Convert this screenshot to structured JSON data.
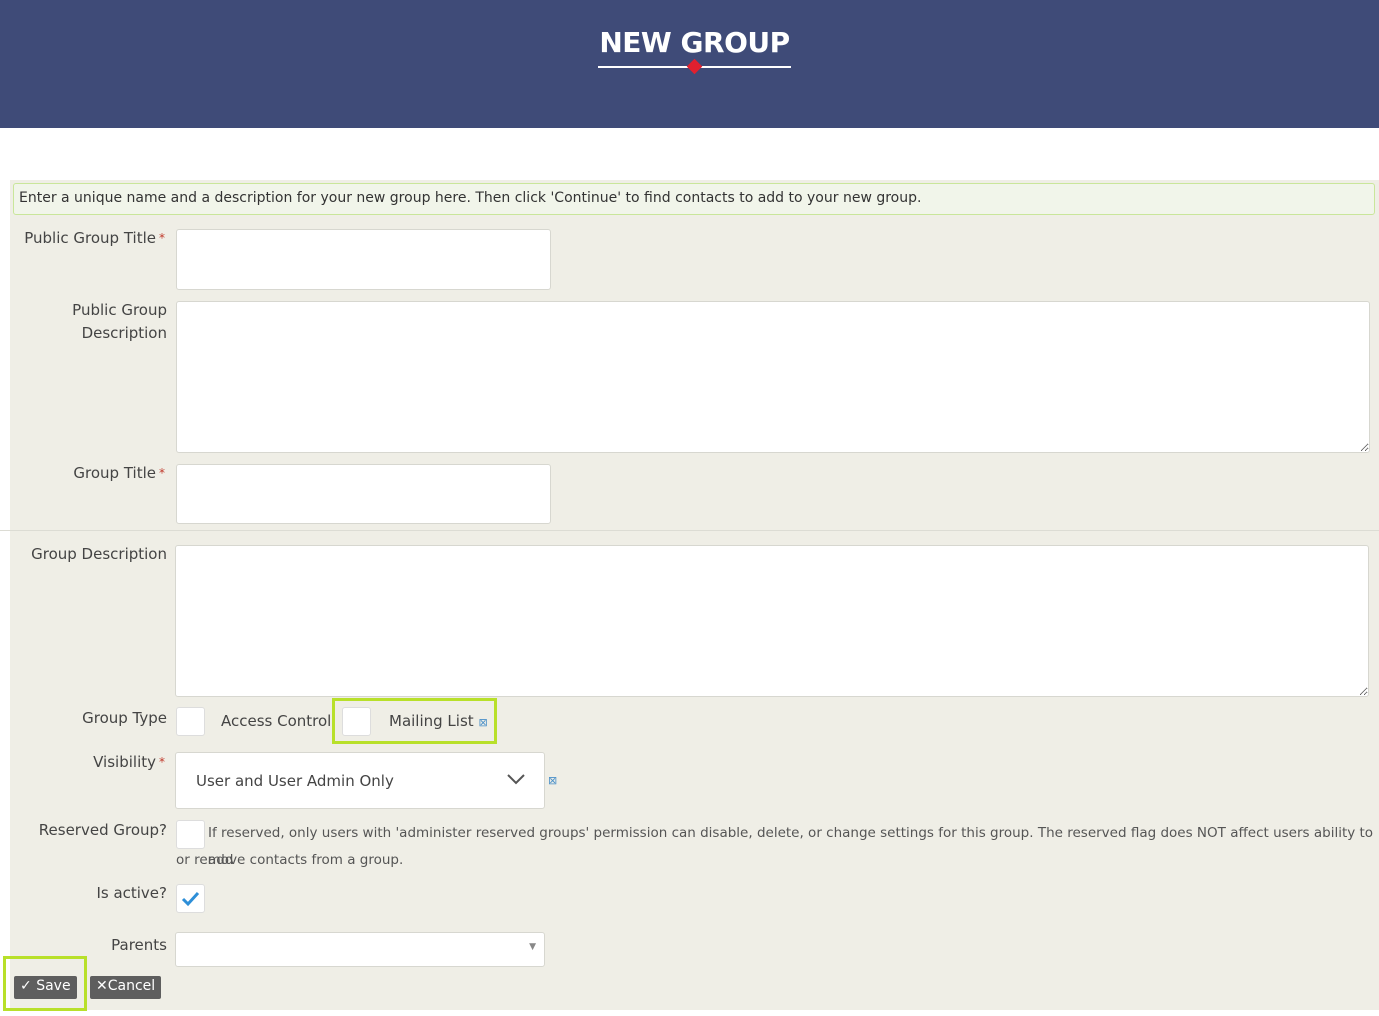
{
  "header": {
    "title": "NEW GROUP"
  },
  "help_text": "Enter a unique name and a description for your new group here. Then click 'Continue' to find contacts to add to your new group.",
  "form": {
    "public_title_label": "Public Group Title",
    "public_desc_label_1": "Public Group",
    "public_desc_label_2": "Description",
    "group_title_label": "Group Title",
    "group_desc_label": "Group Description",
    "group_type_label": "Group Type",
    "group_type_options": [
      "Access Control",
      "Mailing List"
    ],
    "visibility_label": "Visibility",
    "visibility_value": "User and User Admin Only",
    "reserved_label": "Reserved Group?",
    "reserved_help_1": "If reserved, only users with 'administer reserved groups' permission can disable, delete, or change settings for this group. The reserved flag does NOT affect users ability to add",
    "reserved_help_2": "or remove contacts from a group.",
    "active_label": "Is active?",
    "active_checked": true,
    "parents_label": "Parents",
    "required_mark": "*",
    "help_icon": "⊠"
  },
  "buttons": {
    "save": "Save",
    "cancel": "Cancel"
  },
  "colors": {
    "header": "#3f4b78",
    "accent": "#e0202f",
    "highlight": "#b8e02a",
    "checkmark": "#2e8fd8"
  }
}
